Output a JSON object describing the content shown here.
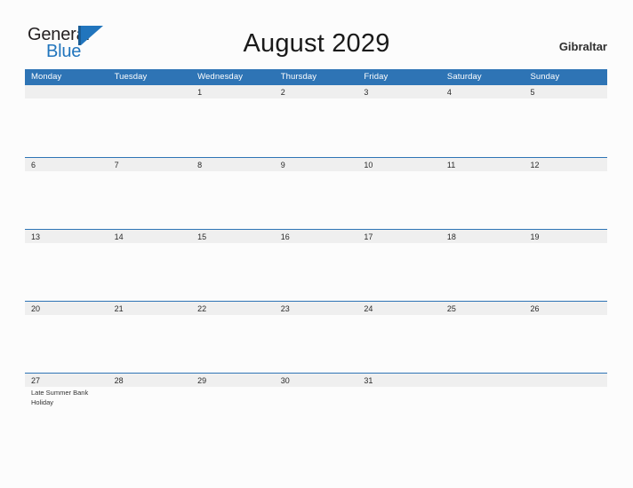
{
  "branding": {
    "name_part1": "General",
    "name_part2": "Blue",
    "mark_icon": "triangle-logo-icon",
    "accent_color": "#2175bd"
  },
  "header": {
    "title": "August 2029",
    "location": "Gibraltar"
  },
  "theme": {
    "header_blue": "#2e74b5",
    "band_gray": "#efefef",
    "page_background": "#fcfcfc",
    "text_color": "#2a2a2a"
  },
  "calendar": {
    "weekdays": [
      "Monday",
      "Tuesday",
      "Wednesday",
      "Thursday",
      "Friday",
      "Saturday",
      "Sunday"
    ],
    "weeks": [
      [
        {
          "day": ""
        },
        {
          "day": ""
        },
        {
          "day": "1"
        },
        {
          "day": "2"
        },
        {
          "day": "3"
        },
        {
          "day": "4"
        },
        {
          "day": "5"
        }
      ],
      [
        {
          "day": "6"
        },
        {
          "day": "7"
        },
        {
          "day": "8"
        },
        {
          "day": "9"
        },
        {
          "day": "10"
        },
        {
          "day": "11"
        },
        {
          "day": "12"
        }
      ],
      [
        {
          "day": "13"
        },
        {
          "day": "14"
        },
        {
          "day": "15"
        },
        {
          "day": "16"
        },
        {
          "day": "17"
        },
        {
          "day": "18"
        },
        {
          "day": "19"
        }
      ],
      [
        {
          "day": "20"
        },
        {
          "day": "21"
        },
        {
          "day": "22"
        },
        {
          "day": "23"
        },
        {
          "day": "24"
        },
        {
          "day": "25"
        },
        {
          "day": "26"
        }
      ],
      [
        {
          "day": "27",
          "event": "Late Summer Bank Holiday"
        },
        {
          "day": "28"
        },
        {
          "day": "29"
        },
        {
          "day": "30"
        },
        {
          "day": "31"
        },
        {
          "day": ""
        },
        {
          "day": ""
        }
      ]
    ]
  }
}
